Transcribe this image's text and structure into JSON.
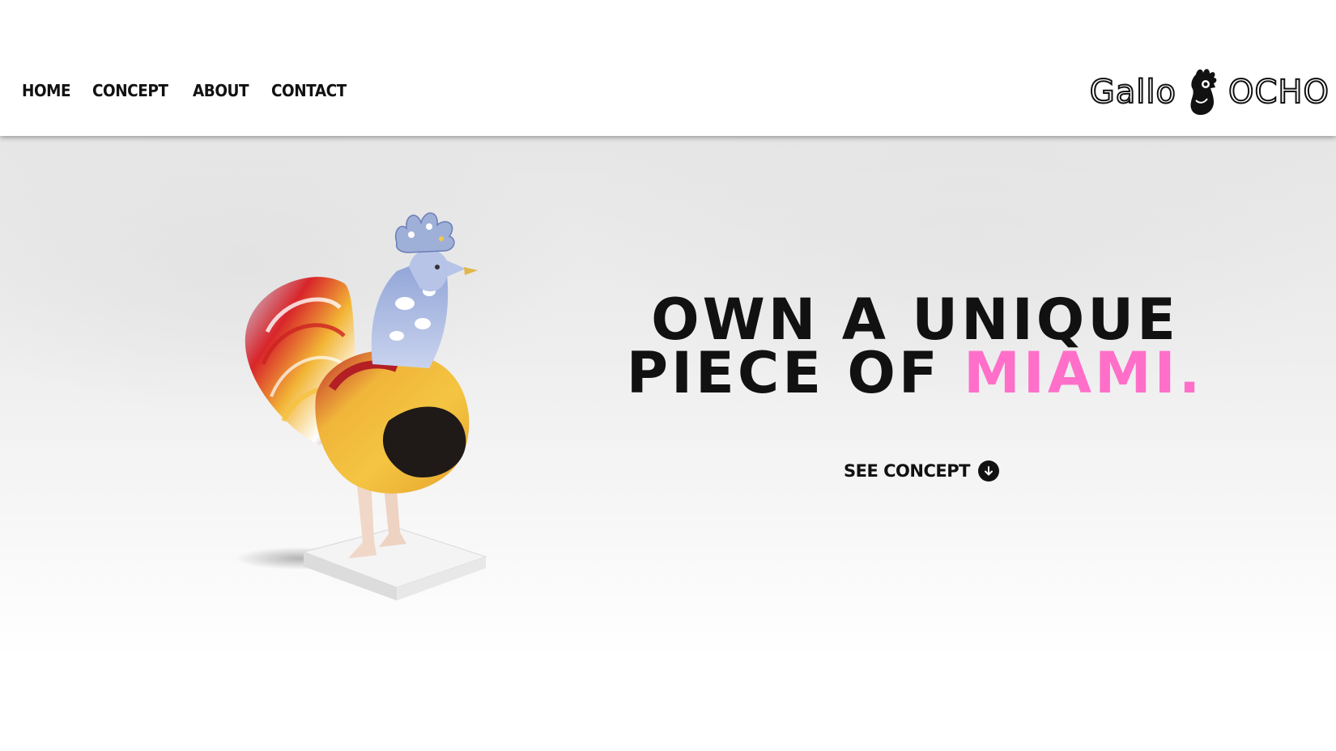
{
  "nav": {
    "items": [
      {
        "label": "HOME"
      },
      {
        "label": "CONCEPT"
      },
      {
        "label": "ABOUT"
      },
      {
        "label": "CONTACT"
      }
    ]
  },
  "logo": {
    "word_left": "Gallo",
    "word_right": "OCHO",
    "icon": "rooster-logo-icon"
  },
  "hero": {
    "headline_line1": "Own a Unique",
    "headline_line2_prefix": "Piece of ",
    "headline_highlight": "Miami.",
    "highlight_color": "#ff6fc9",
    "cta_label": "SEE CONCEPT",
    "cta_icon": "arrow-down-circle-icon",
    "image": "painted-rooster-sculpture"
  }
}
